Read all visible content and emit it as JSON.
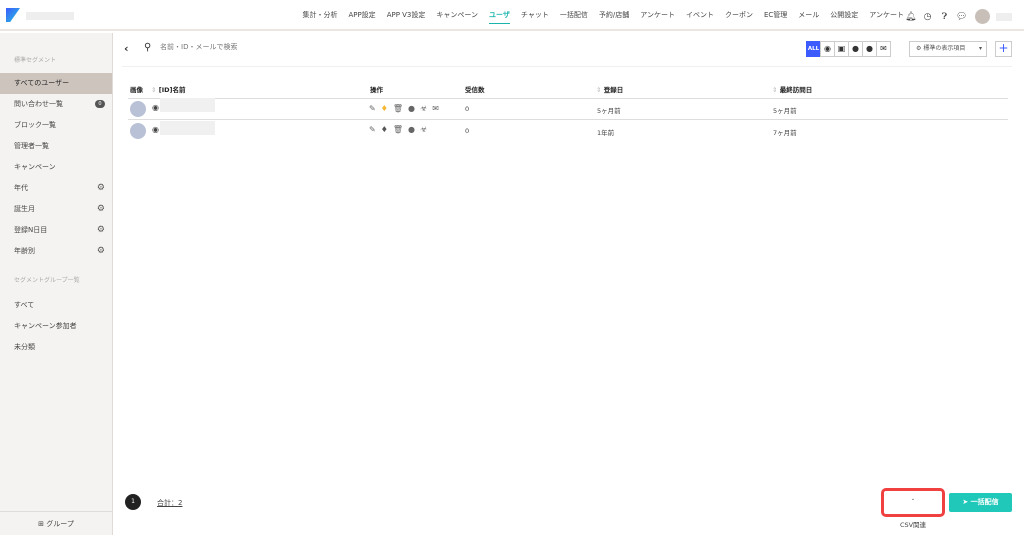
{
  "header": {
    "nav": [
      "集計・分析",
      "APP設定",
      "APP V3設定",
      "キャンペーン",
      "ユーザ",
      "チャット",
      "一括配信",
      "予約/店舗",
      "アンケート",
      "イベント",
      "クーポン",
      "EC管理",
      "メール",
      "公開設定",
      "アンケート"
    ],
    "active_nav": "ユーザ",
    "icons": [
      "bell-icon",
      "clock-icon",
      "help-icon",
      "chat-icon"
    ]
  },
  "sidebar": {
    "segment_heading": "標準セグメント",
    "items": [
      {
        "label": "すべてのユーザー",
        "active": true
      },
      {
        "label": "問い合わせ一覧",
        "badge": "0"
      },
      {
        "label": "ブロック一覧"
      },
      {
        "label": "管理者一覧"
      },
      {
        "label": "キャンペーン"
      },
      {
        "label": "年代",
        "gear": true
      },
      {
        "label": "誕生月",
        "gear": true
      },
      {
        "label": "登録N日目",
        "gear": true
      },
      {
        "label": "年齢別",
        "gear": true
      }
    ],
    "group_heading": "セグメントグループ一覧",
    "groups": [
      "すべて",
      "キャンペーン参加者",
      "未分類"
    ],
    "footer_button": "グループ"
  },
  "toolbar": {
    "search_placeholder": "名前・ID・メールで検索",
    "filters": [
      "ALL",
      "chrome-icon",
      "instagram-icon",
      "messenger-icon",
      "line-icon",
      "mail-icon"
    ],
    "display_select": "標準の表示項目",
    "accent": "#3b5bff"
  },
  "table": {
    "headers": {
      "image": "画像",
      "name": "[ID]名前",
      "ops": "操作",
      "received": "受信数",
      "registered": "登録日",
      "last_visit": "最終訪問日"
    },
    "rows": [
      {
        "received": "0",
        "registered": "5ヶ月前",
        "last_visit": "5ヶ月前",
        "tag_color": "#f5b731",
        "has_mail": true
      },
      {
        "received": "0",
        "registered": "1年前",
        "last_visit": "7ヶ月前",
        "tag_color": "#555555",
        "has_mail": false
      }
    ]
  },
  "footer": {
    "page": "1",
    "total": "合計：2",
    "csv_button": "CSV関連",
    "bulk_button": "一括配信",
    "bulk_color": "#1fc8b8",
    "highlight_color": "#f04040"
  }
}
